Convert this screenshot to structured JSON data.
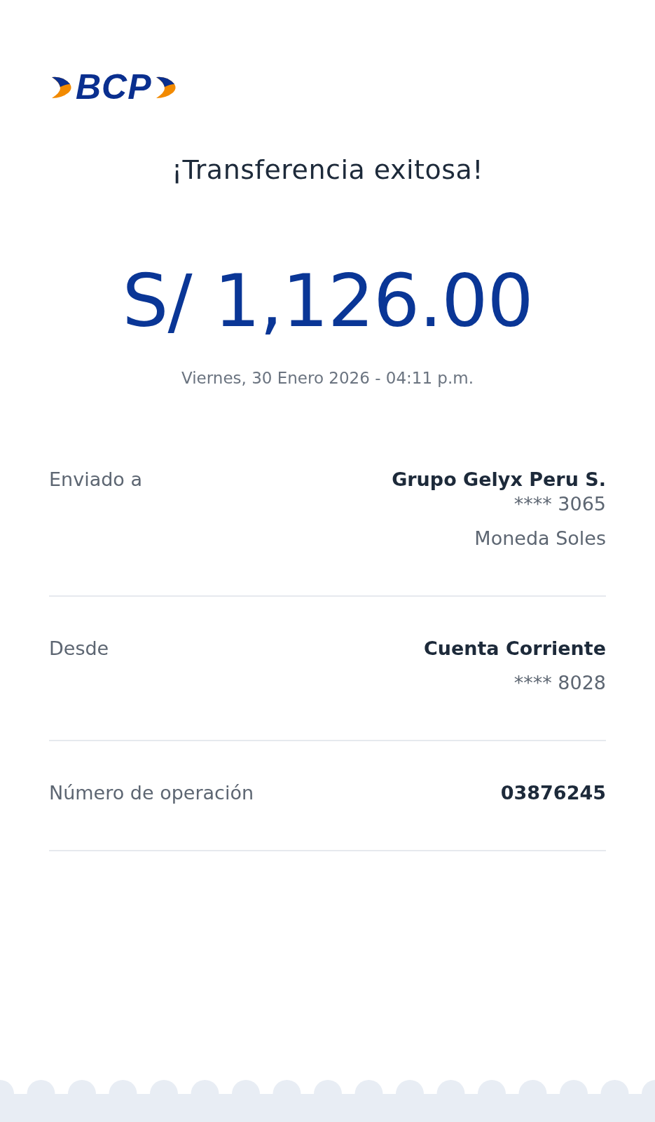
{
  "logo": {
    "text": "BCP"
  },
  "title": "¡Transferencia exitosa!",
  "amount": "S/ 1,126.00",
  "date": "Viernes, 30 Enero 2026 - 04:11 p.m.",
  "details": [
    {
      "label": "Enviado a",
      "values": [
        {
          "text": "Grupo Gelyx Peru S.",
          "kind": "strong"
        },
        {
          "text": "**** 3065",
          "kind": "plain"
        },
        {
          "text": "Moneda Soles",
          "kind": "note"
        }
      ]
    },
    {
      "label": "Desde",
      "values": [
        {
          "text": "Cuenta Corriente",
          "kind": "strong"
        },
        {
          "text": "**** 8028",
          "kind": "note"
        }
      ]
    },
    {
      "label": "Número de operación",
      "values": [
        {
          "text": "03876245",
          "kind": "strong"
        }
      ]
    }
  ]
}
